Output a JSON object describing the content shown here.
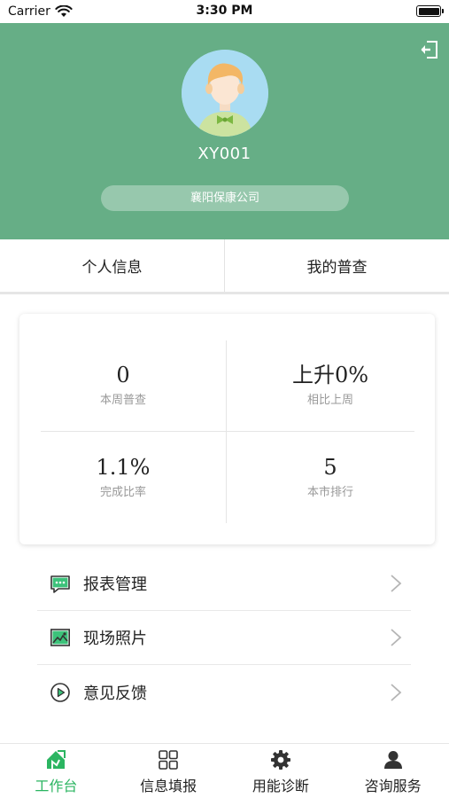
{
  "status_bar": {
    "carrier": "Carrier",
    "time": "3:30 PM"
  },
  "header": {
    "username": "XY001",
    "company": "襄阳保康公司",
    "accent_color": "#66ae86"
  },
  "tabs": [
    {
      "label": "个人信息"
    },
    {
      "label": "我的普查"
    }
  ],
  "stats": [
    {
      "value": "0",
      "label": "本周普查"
    },
    {
      "value": "上升0%",
      "label": "相比上周"
    },
    {
      "value": "1.1%",
      "label": "完成比率"
    },
    {
      "value": "5",
      "label": "本市排行"
    }
  ],
  "menu": [
    {
      "label": "报表管理",
      "icon": "report-icon"
    },
    {
      "label": "现场照片",
      "icon": "photo-icon"
    },
    {
      "label": "意见反馈",
      "icon": "feedback-icon"
    }
  ],
  "bottom_nav": [
    {
      "label": "工作台",
      "icon": "workbench-icon",
      "active": true
    },
    {
      "label": "信息填报",
      "icon": "grid-icon",
      "active": false
    },
    {
      "label": "用能诊断",
      "icon": "gear-icon",
      "active": false
    },
    {
      "label": "咨询服务",
      "icon": "user-icon",
      "active": false
    }
  ],
  "colors": {
    "active_tab": "#2bb561",
    "header_bg": "#66ae86"
  }
}
